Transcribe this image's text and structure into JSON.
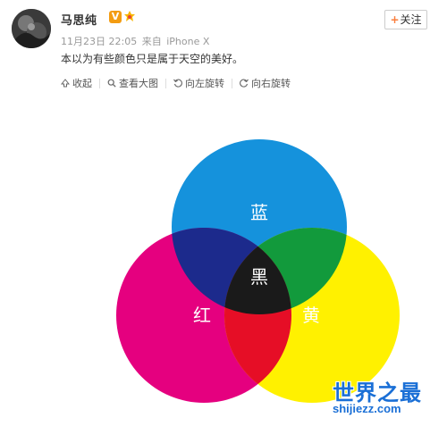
{
  "post": {
    "username": "马思纯",
    "verified_mark": "V",
    "follow_label": "关注",
    "follow_plus": "+",
    "time": "11月23日 22:05",
    "source_prefix": "来自",
    "source": "iPhone X",
    "text": "本以为有些颜色只是属于天空的美好。"
  },
  "toolbar": {
    "items": [
      {
        "label": "收起",
        "icon": "collapse-icon"
      },
      {
        "label": "查看大图",
        "icon": "magnifier-icon"
      },
      {
        "label": "向左旋转",
        "icon": "rotate-left-icon"
      },
      {
        "label": "向右旋转",
        "icon": "rotate-right-icon"
      }
    ]
  },
  "diagram": {
    "labels": {
      "blue": "蓝",
      "red": "红",
      "yellow": "黄",
      "black": "黑"
    },
    "colors": {
      "blue": "#1592dc",
      "red": "#e5007f",
      "yellow": "#fff100",
      "blue_red": "#1c2a8c",
      "blue_yellow": "#129a3c",
      "red_yellow": "#e60e26",
      "center": "#1a1a1a"
    }
  },
  "watermark": {
    "title": "世界之最",
    "url": "shijiezz.com"
  }
}
